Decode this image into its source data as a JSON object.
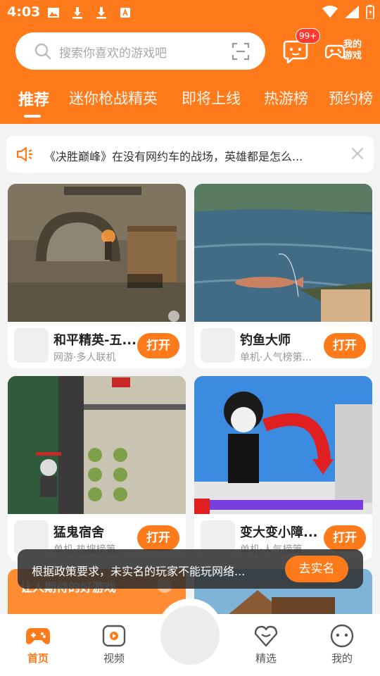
{
  "status_bar": {
    "time": "4:03"
  },
  "search": {
    "placeholder": "搜索你喜欢的游戏吧"
  },
  "header": {
    "message_badge": "99+",
    "my_games_label": "我的游戏"
  },
  "tabs": [
    {
      "label": "推荐",
      "active": true
    },
    {
      "label": "迷你枪战精英"
    },
    {
      "label": "即将上线"
    },
    {
      "label": "热游榜"
    },
    {
      "label": "预约榜"
    }
  ],
  "notice": {
    "text": "《决胜巅峰》在没有网约车的战场，英雄都是怎么..."
  },
  "cards": [
    {
      "title": "和平精英-五...",
      "subtitle": "网游·多人联机",
      "button": "打开"
    },
    {
      "title": "钓鱼大师",
      "subtitle": "单机·人气榜第...",
      "button": "打开"
    },
    {
      "title": "猛鬼宿舍",
      "subtitle": "单机·热搜榜第...",
      "button": "打开"
    },
    {
      "title": "变大变小障...",
      "subtitle": "单机·人气榜第...",
      "button": "打开"
    }
  ],
  "promo": {
    "title": "让人期待的好游戏"
  },
  "toast": {
    "text": "根据政策要求，未实名的玩家不能玩网络...",
    "button": "去实名"
  },
  "bottom_nav": [
    {
      "label": "首页",
      "active": true
    },
    {
      "label": "视频"
    },
    {
      "label": "精选"
    },
    {
      "label": "我的"
    }
  ],
  "colors": {
    "accent": "#ff7a1a",
    "badge": "#ff3b30"
  }
}
